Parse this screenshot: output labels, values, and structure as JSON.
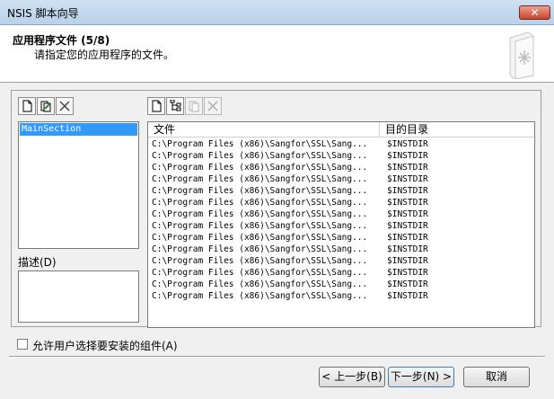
{
  "window": {
    "title": "NSIS 脚本向导",
    "close_label": "✕"
  },
  "header": {
    "title": "应用程序文件 (5/8)",
    "subtitle": "请指定您的应用程序的文件。"
  },
  "sections": {
    "items": [
      "MainSection"
    ],
    "description_label": "描述(D)"
  },
  "files": {
    "columns": [
      "文件",
      "目的目录"
    ],
    "rows": [
      {
        "path": "C:\\Program Files (x86)\\Sangfor\\SSL\\Sang...",
        "dest": "$INSTDIR"
      },
      {
        "path": "C:\\Program Files (x86)\\Sangfor\\SSL\\Sang...",
        "dest": "$INSTDIR"
      },
      {
        "path": "C:\\Program Files (x86)\\Sangfor\\SSL\\Sang...",
        "dest": "$INSTDIR"
      },
      {
        "path": "C:\\Program Files (x86)\\Sangfor\\SSL\\Sang...",
        "dest": "$INSTDIR"
      },
      {
        "path": "C:\\Program Files (x86)\\Sangfor\\SSL\\Sang...",
        "dest": "$INSTDIR"
      },
      {
        "path": "C:\\Program Files (x86)\\Sangfor\\SSL\\Sang...",
        "dest": "$INSTDIR"
      },
      {
        "path": "C:\\Program Files (x86)\\Sangfor\\SSL\\Sang...",
        "dest": "$INSTDIR"
      },
      {
        "path": "C:\\Program Files (x86)\\Sangfor\\SSL\\Sang...",
        "dest": "$INSTDIR"
      },
      {
        "path": "C:\\Program Files (x86)\\Sangfor\\SSL\\Sang...",
        "dest": "$INSTDIR"
      },
      {
        "path": "C:\\Program Files (x86)\\Sangfor\\SSL\\Sang...",
        "dest": "$INSTDIR"
      },
      {
        "path": "C:\\Program Files (x86)\\Sangfor\\SSL\\Sang...",
        "dest": "$INSTDIR"
      },
      {
        "path": "C:\\Program Files (x86)\\Sangfor\\SSL\\Sang...",
        "dest": "$INSTDIR"
      },
      {
        "path": "C:\\Program Files (x86)\\Sangfor\\SSL\\Sang...",
        "dest": "$INSTDIR"
      },
      {
        "path": "C:\\Program Files (x86)\\Sangfor\\SSL\\Sang...",
        "dest": "$INSTDIR"
      }
    ]
  },
  "options": {
    "allow_select_components_label": "允许用户选择要安装的组件(A)",
    "allow_select_components_checked": false
  },
  "buttons": {
    "back": "< 上一步(B)",
    "next": "下一步(N) >",
    "cancel": "取消"
  },
  "colors": {
    "selection": "#3399ff",
    "close": "#c9452e"
  }
}
